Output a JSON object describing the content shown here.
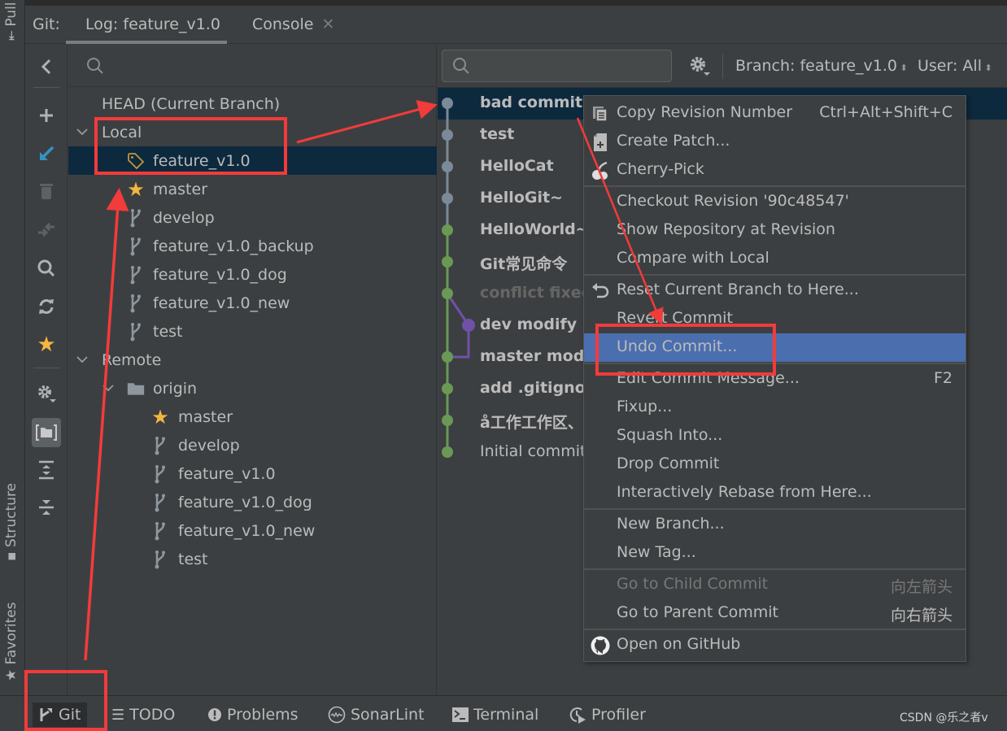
{
  "side_stripe": {
    "top_label": "Pull R",
    "structure_label": "Structure",
    "favorites_label": "Favorites"
  },
  "header": {
    "prefix": "Git:",
    "tabs": [
      {
        "label": "Log: feature_v1.0",
        "active": true
      },
      {
        "label": "Console",
        "closable": true
      }
    ],
    "close_glyph": "✕"
  },
  "toolbar": {
    "icons": [
      "back-icon",
      "add-icon",
      "checkout-icon",
      "delete-icon",
      "compare-icon",
      "search-icon",
      "refresh-icon",
      "favorite-icon",
      "settings-icon",
      "group-by-directory-icon",
      "expand-all-icon",
      "collapse-all-icon"
    ]
  },
  "branches": {
    "head_label": "HEAD (Current Branch)",
    "local_label": "Local",
    "local": [
      {
        "name": "feature_v1.0",
        "icon": "tag",
        "selected": true
      },
      {
        "name": "master",
        "icon": "star"
      },
      {
        "name": "develop",
        "icon": "branch"
      },
      {
        "name": "feature_v1.0_backup",
        "icon": "branch"
      },
      {
        "name": "feature_v1.0_dog",
        "icon": "branch"
      },
      {
        "name": "feature_v1.0_new",
        "icon": "branch"
      },
      {
        "name": "test",
        "icon": "branch"
      }
    ],
    "remote_label": "Remote",
    "remote_group": "origin",
    "remote": [
      {
        "name": "master",
        "icon": "star"
      },
      {
        "name": "develop",
        "icon": "branch"
      },
      {
        "name": "feature_v1.0",
        "icon": "branch"
      },
      {
        "name": "feature_v1.0_dog",
        "icon": "branch"
      },
      {
        "name": "feature_v1.0_new",
        "icon": "branch"
      },
      {
        "name": "test",
        "icon": "branch"
      }
    ]
  },
  "log": {
    "search_placeholder": "",
    "branch_filter": "Branch: feature_v1.0",
    "user_filter": "User: All",
    "commits": [
      {
        "message": "bad commit",
        "selected": true,
        "lane": 0,
        "color": "#7a8a99"
      },
      {
        "message": "test",
        "lane": 0,
        "color": "#7a8a99"
      },
      {
        "message": "HelloCat",
        "lane": 0,
        "color": "#7a8a99"
      },
      {
        "message": "HelloGit~",
        "lane": 0,
        "color": "#7a8a99"
      },
      {
        "message": "HelloWorld~",
        "lane": 0,
        "color": "#6a9955"
      },
      {
        "message": "Git常见命令",
        "lane": 0,
        "color": "#6a9955"
      },
      {
        "message": "conflict fixed",
        "lane": 0,
        "color": "#6a9955",
        "dimmed": true
      },
      {
        "message": "dev modify",
        "lane": 1,
        "color": "#6f52a8"
      },
      {
        "message": "master modi",
        "lane": 0,
        "color": "#6a9955"
      },
      {
        "message": "add .gitignor",
        "lane": 0,
        "color": "#6a9955"
      },
      {
        "message": "å工作工作区、",
        "lane": 0,
        "color": "#6a9955"
      },
      {
        "message": "Initial commit",
        "lane": 0,
        "color": "#6a9955",
        "normal_weight": true
      }
    ]
  },
  "context_menu": {
    "groups": [
      [
        {
          "label": "Copy Revision Number",
          "shortcut": "Ctrl+Alt+Shift+C",
          "icon": "copy-icon"
        },
        {
          "label": "Create Patch...",
          "icon": "patch-icon"
        },
        {
          "label": "Cherry-Pick",
          "icon": "cherry-icon"
        }
      ],
      [
        {
          "label": "Checkout Revision '90c48547'"
        },
        {
          "label": "Show Repository at Revision"
        },
        {
          "label": "Compare with Local"
        }
      ],
      [
        {
          "label": "Reset Current Branch to Here...",
          "icon": "reset-icon"
        },
        {
          "label": "Revert Commit"
        },
        {
          "label": "Undo Commit...",
          "highlighted": true
        }
      ],
      [
        {
          "label": "Edit Commit Message...",
          "shortcut": "F2"
        },
        {
          "label": "Fixup..."
        },
        {
          "label": "Squash Into..."
        },
        {
          "label": "Drop Commit"
        },
        {
          "label": "Interactively Rebase from Here..."
        }
      ],
      [
        {
          "label": "New Branch..."
        },
        {
          "label": "New Tag..."
        }
      ],
      [
        {
          "label": "Go to Child Commit",
          "shortcut": "向左箭头",
          "disabled": true
        },
        {
          "label": "Go to Parent Commit",
          "shortcut": "向右箭头"
        }
      ],
      [
        {
          "label": "Open on GitHub",
          "icon": "github-icon"
        }
      ]
    ]
  },
  "bottom_bar": {
    "items": [
      {
        "label": "Git",
        "icon": "git-icon",
        "active": true
      },
      {
        "label": "TODO",
        "icon": "todo-icon"
      },
      {
        "label": "Problems",
        "icon": "problems-icon"
      },
      {
        "label": "SonarLint",
        "icon": "sonarlint-icon"
      },
      {
        "label": "Terminal",
        "icon": "terminal-icon"
      },
      {
        "label": "Profiler",
        "icon": "profiler-icon"
      }
    ],
    "watermark": "CSDN @乐之者v"
  },
  "colors": {
    "selection": "#0d293e",
    "menu_highlight": "#4b6eaf",
    "annotation_red": "#f23b3b",
    "star": "#f4b63f",
    "checkout_blue": "#3592c4",
    "graph_gray": "#7a8a99",
    "graph_green": "#6a9955",
    "graph_purple": "#6f52a8"
  }
}
